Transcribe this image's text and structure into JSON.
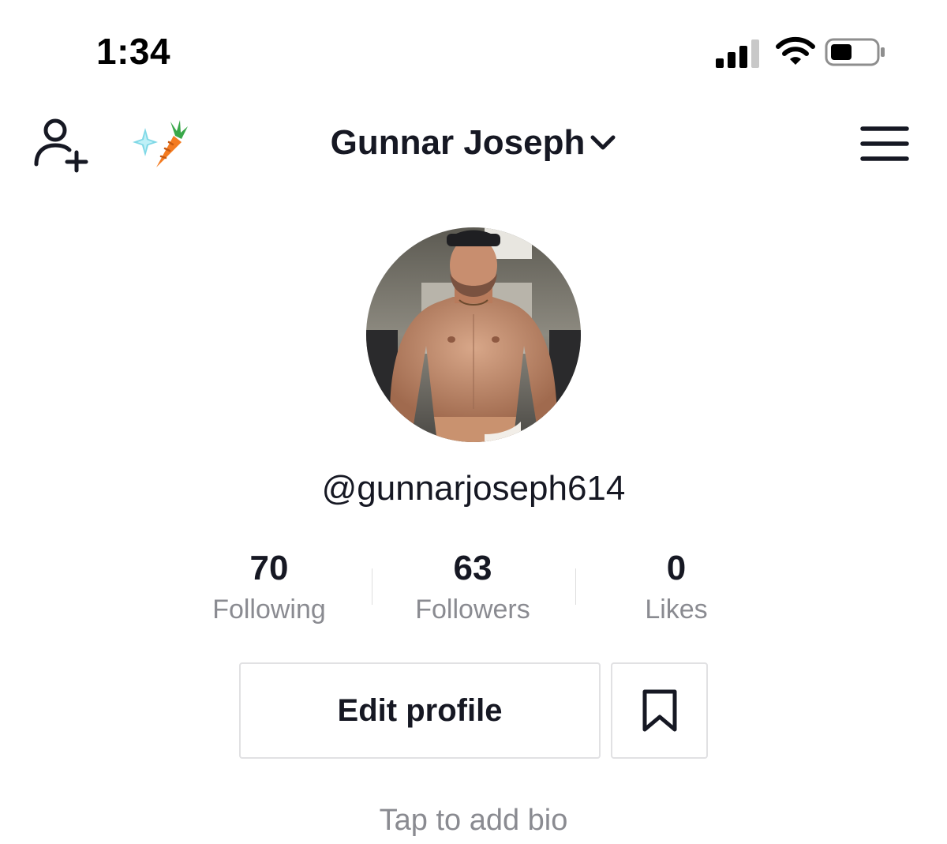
{
  "status_bar": {
    "time": "1:34",
    "icons": [
      "cellular-signal-icon",
      "wifi-icon",
      "battery-icon"
    ]
  },
  "nav": {
    "title": "Gunnar Joseph",
    "left_icons": [
      "add-user-icon",
      "sparkle-carrot-icon"
    ],
    "right_icon": "hamburger-menu-icon"
  },
  "profile": {
    "avatar": "profile-photo",
    "username": "@gunnarjoseph614",
    "stats": [
      {
        "value": "70",
        "label": "Following"
      },
      {
        "value": "63",
        "label": "Followers"
      },
      {
        "value": "0",
        "label": "Likes"
      }
    ],
    "edit_button_label": "Edit profile",
    "bookmark_icon": "bookmark-icon",
    "bio_placeholder": "Tap to add bio"
  },
  "colors": {
    "text_primary": "#161823",
    "text_secondary": "#8a8b91",
    "border": "#e1e1e3",
    "carrot": "#f47b20",
    "sparkle": "#7fd8e6"
  }
}
